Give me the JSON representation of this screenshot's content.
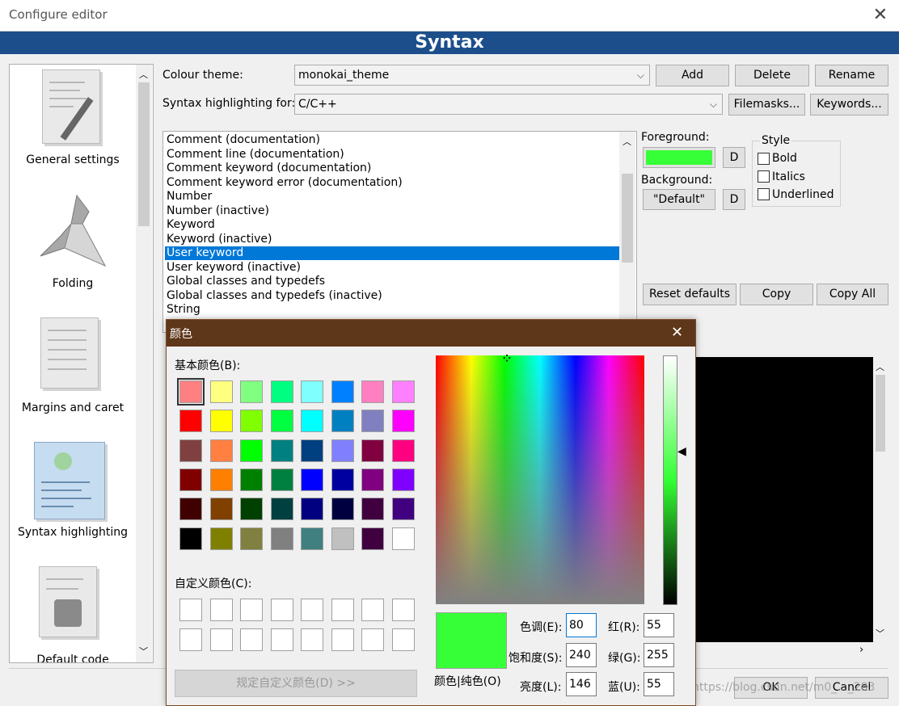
{
  "window": {
    "title": "Configure editor"
  },
  "banner": "Syntax",
  "sidebar": {
    "items": [
      {
        "label": "General settings"
      },
      {
        "label": "Folding"
      },
      {
        "label": "Margins and caret"
      },
      {
        "label": "Syntax highlighting"
      },
      {
        "label": "Default code"
      }
    ]
  },
  "theme": {
    "label": "Colour theme:",
    "value": "monokai_theme",
    "add": "Add",
    "delete": "Delete",
    "rename": "Rename"
  },
  "syntax": {
    "label": "Syntax highlighting for:",
    "value": "C/C++",
    "filemasks": "Filemasks...",
    "keywords": "Keywords..."
  },
  "styles": [
    "Comment (documentation)",
    "Comment line (documentation)",
    "Comment keyword (documentation)",
    "Comment keyword error (documentation)",
    "Number",
    "Number (inactive)",
    "Keyword",
    "Keyword (inactive)",
    "User keyword",
    "User keyword (inactive)",
    "Global classes and typedefs",
    "Global classes and typedefs (inactive)",
    "String"
  ],
  "selected_style": "User keyword",
  "foreground": {
    "label": "Foreground:",
    "color": "#37ff37",
    "d": "D"
  },
  "background": {
    "label": "Background:",
    "value": "\"Default\"",
    "d": "D"
  },
  "style": {
    "title": "Style",
    "bold": "Bold",
    "italics": "Italics",
    "underlined": "Underlined"
  },
  "actions": {
    "reset": "Reset defaults",
    "copy": "Copy",
    "copy_all": "Copy All"
  },
  "footer": {
    "ok": "OK",
    "cancel": "Cancel",
    "watermark": "https://blog.csdn.net/m0_..._283"
  },
  "color_dialog": {
    "title": "颜色",
    "basic_label": "基本颜色(B):",
    "custom_label": "自定义颜色(C):",
    "define_button": "规定自定义颜色(D) >>",
    "solid_label": "颜色|纯色(O)",
    "hue_label": "色调(E):",
    "hue": "80",
    "sat_label": "饱和度(S):",
    "sat": "240",
    "lum_label": "亮度(L):",
    "lum": "146",
    "red_label": "红(R):",
    "red": "55",
    "green_label": "绿(G):",
    "green": "255",
    "blue_label": "蓝(U):",
    "blue": "55",
    "current_color": "#37ff37",
    "basic_colors": [
      "#ff8080",
      "#ffff80",
      "#80ff80",
      "#00ff80",
      "#80ffff",
      "#0080ff",
      "#ff80c0",
      "#ff80ff",
      "#ff0000",
      "#ffff00",
      "#80ff00",
      "#00ff40",
      "#00ffff",
      "#0080c0",
      "#8080c0",
      "#ff00ff",
      "#804040",
      "#ff8040",
      "#00ff00",
      "#008080",
      "#004080",
      "#8080ff",
      "#800040",
      "#ff0080",
      "#800000",
      "#ff8000",
      "#008000",
      "#008040",
      "#0000ff",
      "#0000a0",
      "#800080",
      "#8000ff",
      "#400000",
      "#804000",
      "#004000",
      "#004040",
      "#000080",
      "#000040",
      "#400040",
      "#400080",
      "#000000",
      "#808000",
      "#808040",
      "#808080",
      "#408080",
      "#c0c0c0",
      "#400040",
      "#ffffff"
    ]
  }
}
